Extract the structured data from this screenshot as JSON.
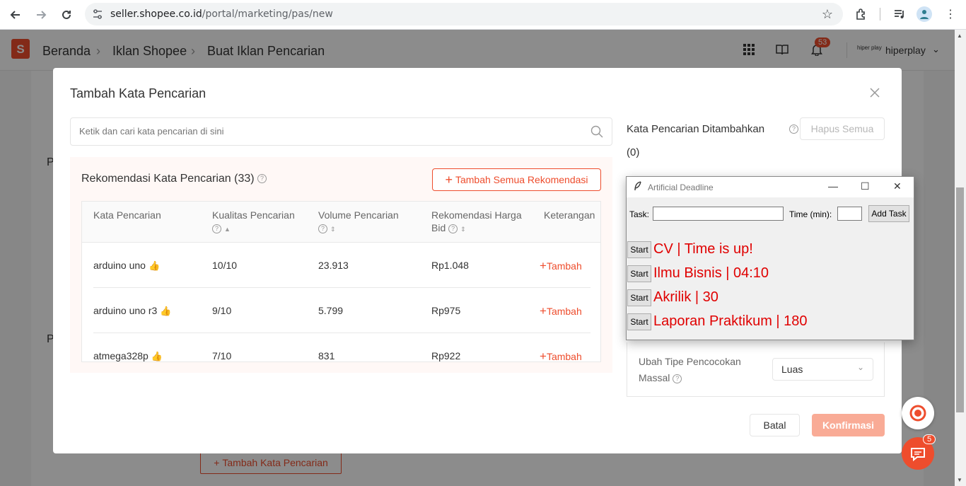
{
  "browser": {
    "url_host": "seller.shopee.co.id",
    "url_path": "/portal/marketing/pas/new"
  },
  "header": {
    "breadcrumb": [
      "Beranda",
      "Iklan Shopee",
      "Buat Iklan Pencarian"
    ],
    "notification_count": "53",
    "user_name": "hiperplay",
    "user_logo_text": "hiper play"
  },
  "background": {
    "add_keyword_button": "Tambah Kata Pencarian",
    "letter_1": "P",
    "letter_2": "P"
  },
  "modal": {
    "title": "Tambah Kata Pencarian",
    "search_placeholder": "Ketik dan cari kata pencarian di sini",
    "recommendation_title": "Rekomendasi Kata Pencarian (33)",
    "add_all_label": "Tambah Semua Rekomendasi",
    "columns": [
      "Kata Pencarian",
      "Kualitas Pencarian",
      "Volume Pencarian",
      "Rekomendasi Harga Bid",
      "Keterangan"
    ],
    "rows": [
      {
        "keyword": "arduino uno",
        "quality": "10/10",
        "volume": "23.913",
        "bid": "Rp1.048",
        "action": "Tambah"
      },
      {
        "keyword": "arduino uno r3",
        "quality": "9/10",
        "volume": "5.799",
        "bid": "Rp975",
        "action": "Tambah"
      },
      {
        "keyword": "atmega328p",
        "quality": "7/10",
        "volume": "831",
        "bid": "Rp922",
        "action": "Tambah"
      }
    ],
    "added_title": "Kata Pencarian Ditambahkan",
    "added_count": "(0)",
    "clear_all_label": "Hapus Semua",
    "match_type_label_1": "Ubah Tipe Pencocokan",
    "match_type_label_2": "Massal",
    "match_type_value": "Luas",
    "cancel_label": "Batal",
    "confirm_label": "Konfirmasi"
  },
  "floating": {
    "chat_badge": "5"
  },
  "tk_window": {
    "title": "Artificial Deadline",
    "task_label": "Task:",
    "time_label": "Time (min):",
    "add_task_label": "Add Task",
    "start_label": "Start",
    "tasks": [
      "CV | Time is up!",
      "Ilmu Bisnis | 04:10",
      "Akrilik | 30",
      "Laporan Praktikum | 180"
    ]
  },
  "colors": {
    "brand": "#ee4d2d",
    "task_text": "#e00000",
    "confirm_disabled": "#f9ab96"
  }
}
